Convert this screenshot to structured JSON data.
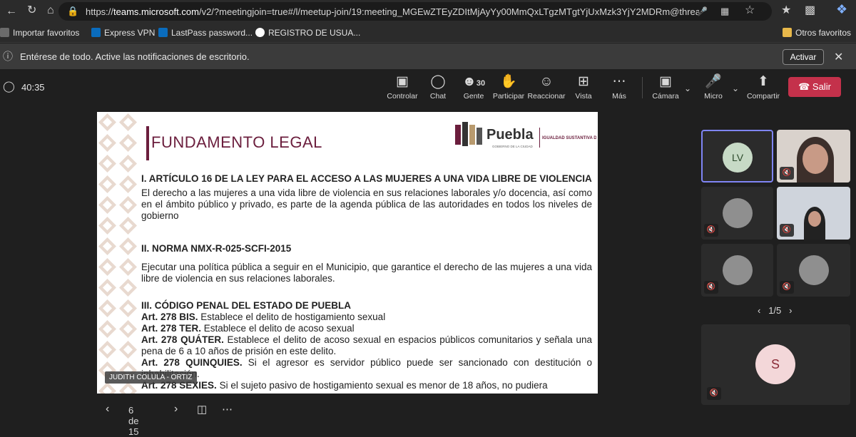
{
  "browser": {
    "url_prefix": "https://",
    "url_host": "teams.microsoft.com",
    "url_path": "/v2/?meetingjoin=true#/l/meetup-join/19:meeting_MGEwZTEyZDItMjAyYy00MmQxLTgzMTgtYjUxMzk3YjY2MDRm@thread..."
  },
  "bookmarks": [
    {
      "label": "Importar favoritos"
    },
    {
      "label": "Express VPN"
    },
    {
      "label": "LastPass password..."
    },
    {
      "label": "REGISTRO DE USUA..."
    }
  ],
  "bookmarks_other": "Otros favoritos",
  "notification": {
    "text": "Entérese de todo. Active las notificaciones de escritorio.",
    "button": "Activar"
  },
  "meeting": {
    "timer": "40:35",
    "toolbar": [
      {
        "label": "Controlar",
        "icon": "share-screen-icon"
      },
      {
        "label": "Chat",
        "icon": "chat-icon"
      },
      {
        "label": "Gente",
        "icon": "people-icon",
        "count": "30"
      },
      {
        "label": "Participar",
        "icon": "raise-hand-icon"
      },
      {
        "label": "Reaccionar",
        "icon": "smile-icon"
      },
      {
        "label": "Vista",
        "icon": "grid-view-icon"
      },
      {
        "label": "Más",
        "icon": "more-icon"
      },
      {
        "label": "Cámara",
        "icon": "camera-off-icon"
      },
      {
        "label": "Micro",
        "icon": "mic-off-icon"
      },
      {
        "label": "Compartir",
        "icon": "share-icon"
      }
    ],
    "leave_button": "Salir"
  },
  "slide": {
    "title": "FUNDAMENTO LEGAL",
    "logo_text": "Puebla",
    "logo_sub": "GOBIERNO DE LA CIUDAD",
    "logo_right": "IGUALDAD SUSTANTIVA DE GÉNERO",
    "section1_head": "I. ARTÍCULO 16 DE LA LEY PARA EL ACCESO A LAS MUJERES A UNA VIDA LIBRE DE VIOLENCIA",
    "section1_body": "El derecho a las mujeres a una vida libre de violencia en sus relaciones laborales y/o docencia, así como en el ámbito público y privado, es parte de la agenda pública de las autoridades en todos los niveles de gobierno",
    "section2_head": "II. NORMA NMX-R-025-SCFI-2015",
    "section2_body": "Ejecutar una política pública a seguir en el Municipio, que garantice el derecho de las mujeres a una vida libre de violencia en sus relaciones laborales.",
    "section3_head": "III. CÓDIGO PENAL DEL ESTADO DE PUEBLA",
    "articles": [
      {
        "art": "Art. 278 BIS.",
        "text": " Establece el delito de hostigamiento sexual"
      },
      {
        "art": "Art. 278 TER.",
        "text": " Establece el delito de acoso sexual"
      },
      {
        "art": "Art. 278 QUÁTER.",
        "text": " Establece el delito de acoso sexual en espacios públicos comunitarios y señala una pena de 6 a 10 años de prisión en este delito."
      },
      {
        "art": "Art. 278 QUINQUIES.",
        "text": " Si el agresor es servidor público puede ser sancionado con destitución o inhabilitación."
      },
      {
        "art": "Art. 278 SEXIES.",
        "text": " Si el sujeto pasivo de hostigamiento sexual es menor de 18 años, no pudiera"
      }
    ],
    "presenter": "JUDITH COLULA - ORTIZ",
    "page_indicator": "6 de 15"
  },
  "participants": {
    "tiles": [
      {
        "initials": "LV"
      },
      {
        "initials": ""
      },
      {
        "initials": ""
      },
      {
        "initials": ""
      },
      {
        "initials": ""
      },
      {
        "initials": ""
      }
    ],
    "pager": "1/5",
    "extra": {
      "initials": "S"
    }
  }
}
